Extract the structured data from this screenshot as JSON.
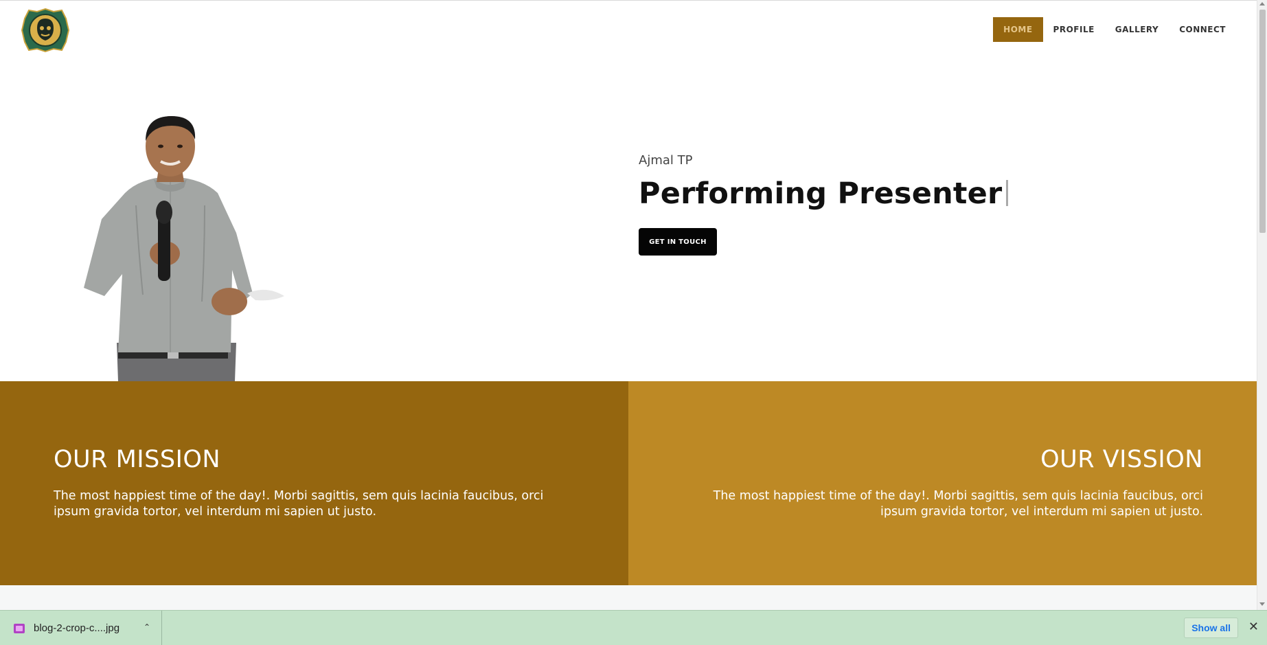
{
  "nav": {
    "items": [
      {
        "label": "HOME",
        "active": true
      },
      {
        "label": "PROFILE",
        "active": false
      },
      {
        "label": "GALLERY",
        "active": false
      },
      {
        "label": "CONNECT",
        "active": false
      }
    ]
  },
  "hero": {
    "name": "Ajmal TP",
    "title": "Performing Presenter",
    "cta": "GET IN TOUCH"
  },
  "mission": {
    "heading": "OUR MISSION",
    "text": "The most happiest time of the day!. Morbi sagittis, sem quis lacinia faucibus, orci ipsum gravida tortor, vel interdum mi sapien ut justo."
  },
  "vision": {
    "heading": "OUR VISSION",
    "text": "The most happiest time of the day!. Morbi sagittis, sem quis lacinia faucibus, orci ipsum gravida tortor, vel interdum mi sapien ut justo."
  },
  "downloads": {
    "file_name": "blog-2-crop-c....jpg",
    "show_all": "Show all"
  },
  "colors": {
    "brand_dark": "#95660f",
    "brand_light": "#bd8925",
    "button": "#050505",
    "shelf": "#c4e3c9"
  },
  "icons": [
    "logo-emblem",
    "image-file-icon",
    "chevron-up-icon",
    "close-icon"
  ]
}
